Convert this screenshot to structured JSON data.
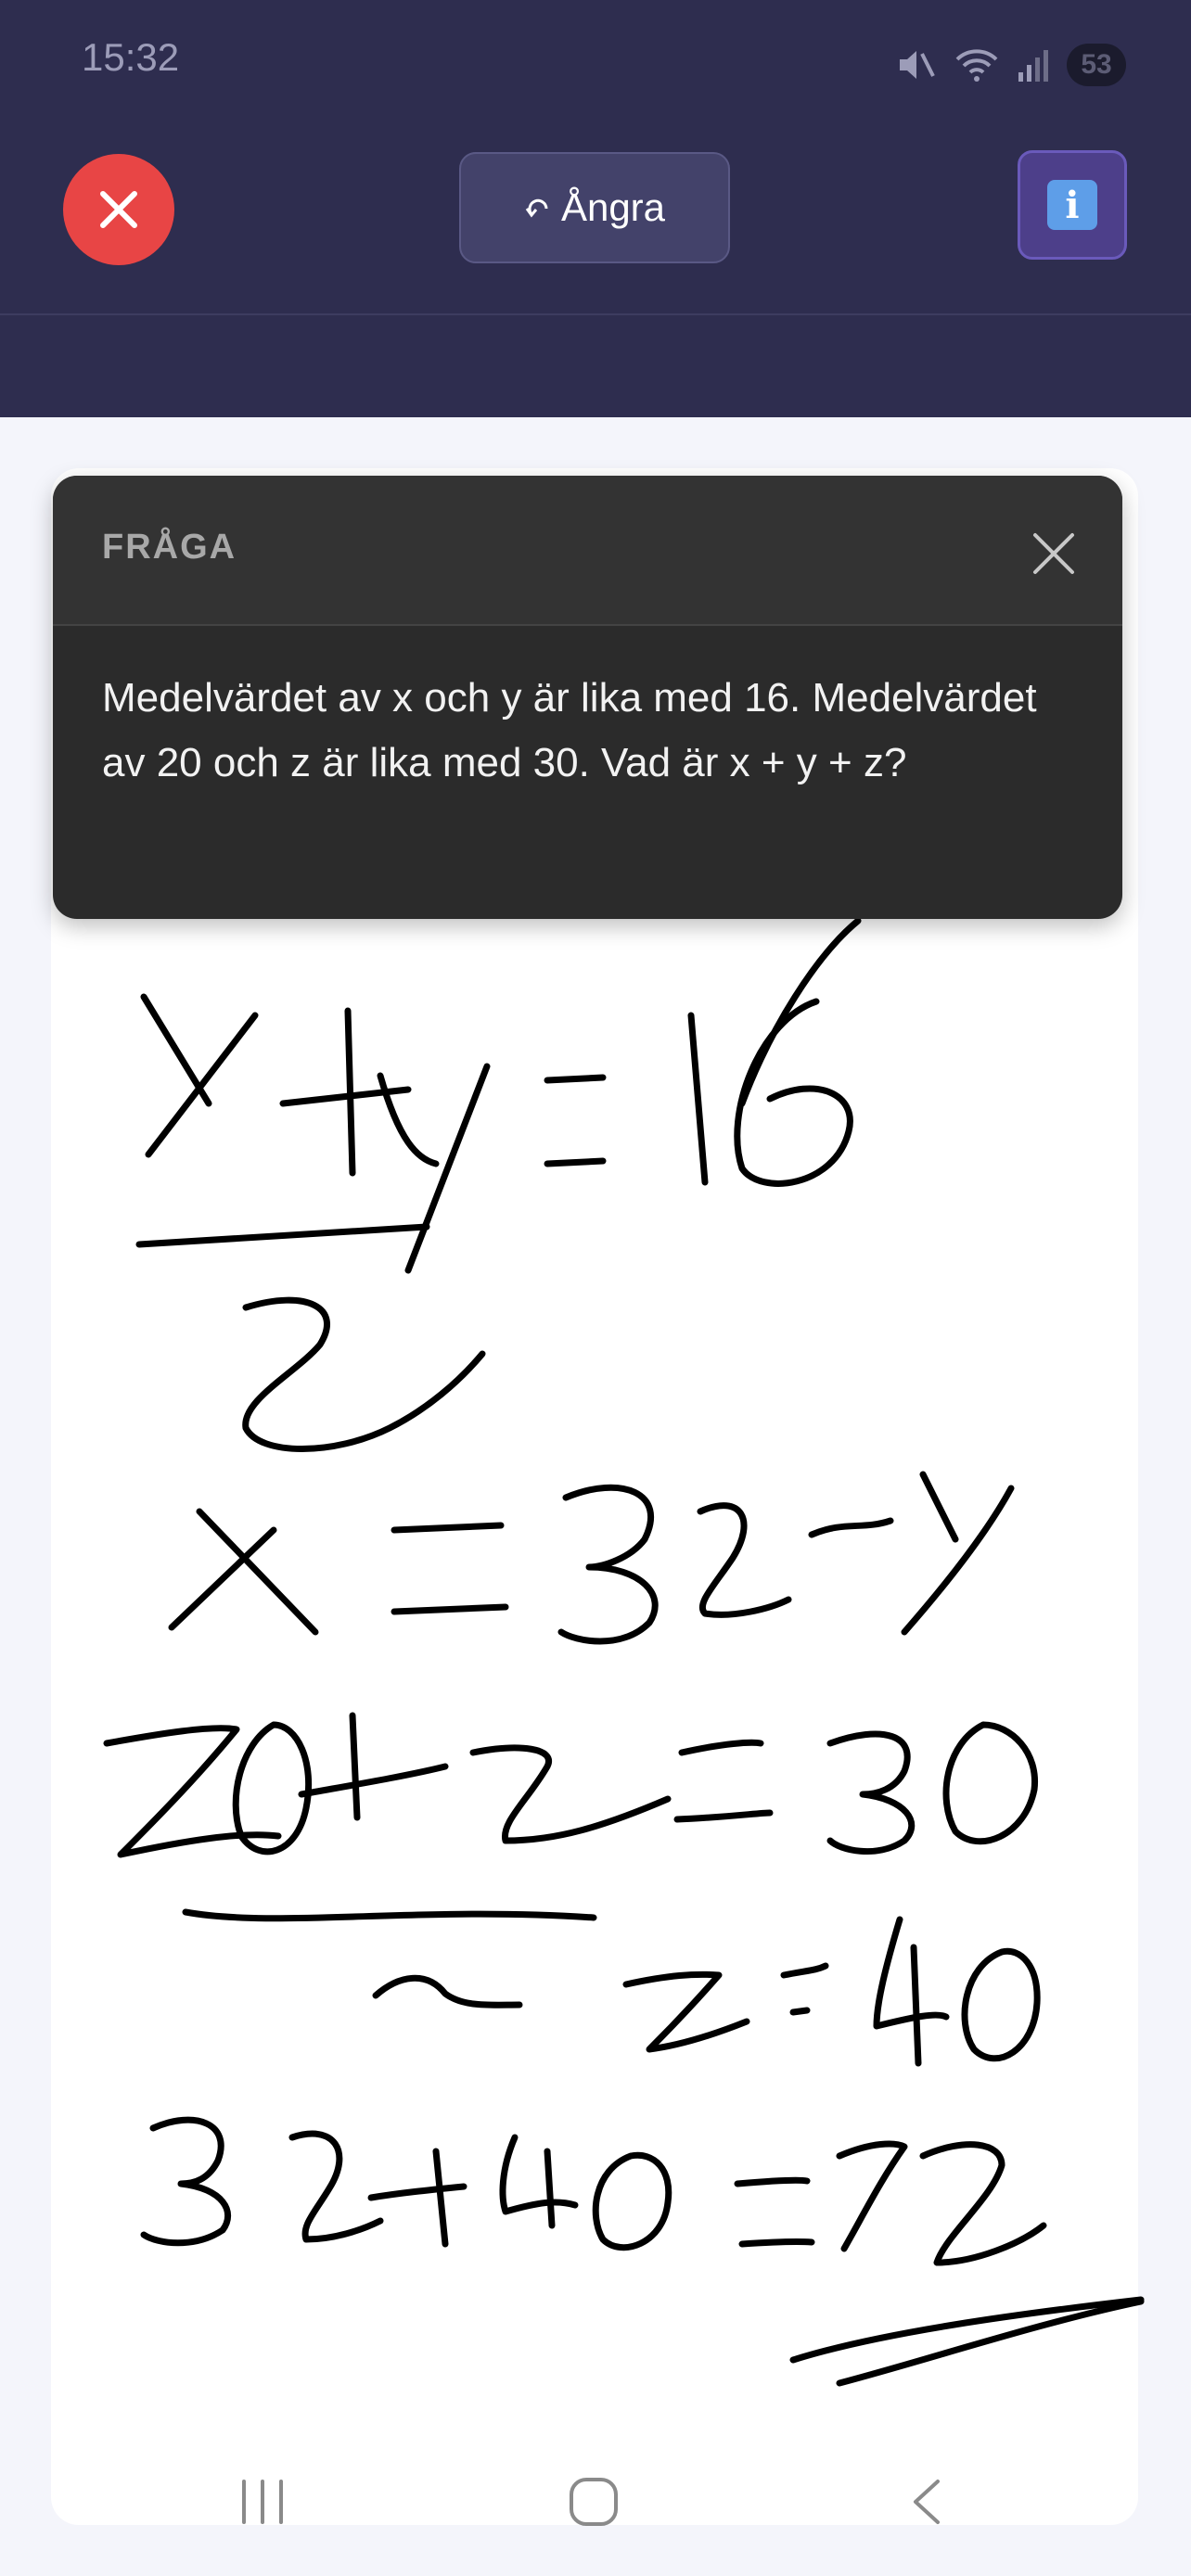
{
  "status_bar": {
    "time": "15:32",
    "battery": "53",
    "icons": [
      "mute-icon",
      "wifi-icon",
      "signal-icon",
      "battery-icon"
    ]
  },
  "toolbar": {
    "close_icon": "close-icon",
    "undo_label": "Ångra",
    "undo_icon": "undo-arrow-icon",
    "info_icon": "info-icon",
    "info_glyph": "i"
  },
  "question": {
    "label": "FRÅGA",
    "text": "Medelvärdet av x och y är lika med 16. Medelvärdet av 20 och z är lika med 30. Vad är x + y + z?"
  },
  "nav_bar": {
    "icons": [
      "recent-apps-icon",
      "home-icon",
      "back-icon"
    ]
  },
  "colors": {
    "topbar": "#2e2d4f",
    "close_button": "#e84545",
    "info_button": "#4d3f8a",
    "card": "#2b2b2b"
  }
}
